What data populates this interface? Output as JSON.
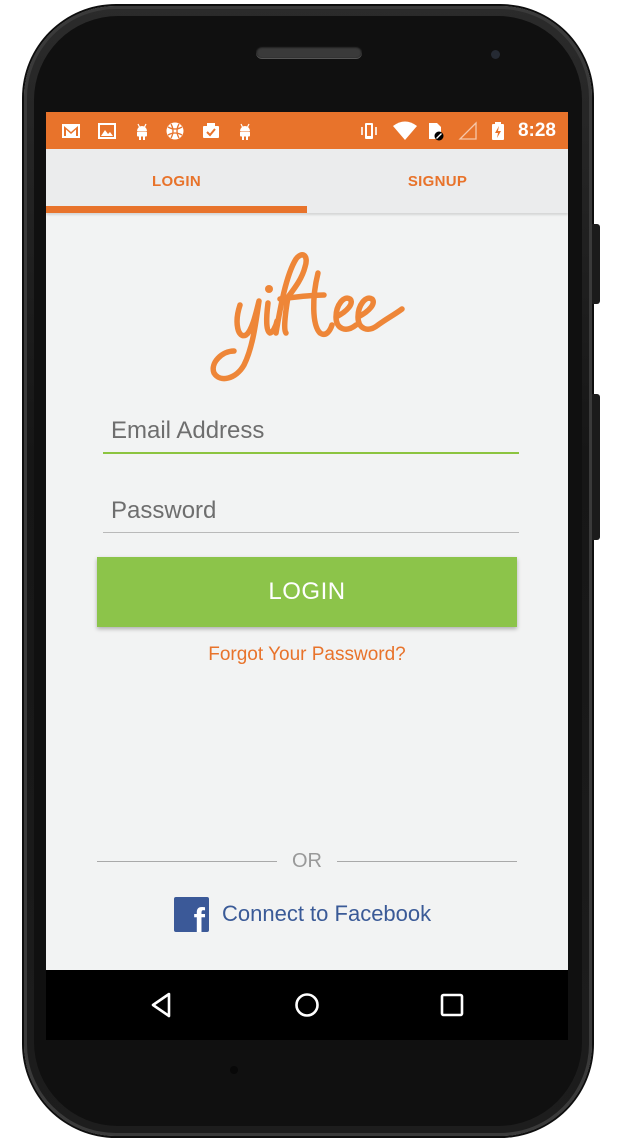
{
  "status_bar": {
    "time": "8:28",
    "left_icons": [
      "gmail-icon",
      "gallery-icon",
      "android-icon",
      "basketball-icon",
      "checklist-icon",
      "android-icon"
    ],
    "right_icons": [
      "vibrate-icon",
      "wifi-icon",
      "sim-blocked-icon",
      "no-signal-icon",
      "battery-charging-icon"
    ],
    "background_color": "#e8732b"
  },
  "tabs": [
    {
      "label": "LOGIN",
      "selected": true
    },
    {
      "label": "SIGNUP",
      "selected": false
    }
  ],
  "logo": {
    "text": "yiftee"
  },
  "form": {
    "email_placeholder": "Email Address",
    "email_value": "",
    "password_placeholder": "Password",
    "password_value": "",
    "login_label": "LOGIN",
    "forgot_label": "Forgot Your Password?"
  },
  "divider": {
    "text": "OR"
  },
  "facebook": {
    "label": "Connect to Facebook",
    "icon": "facebook-icon"
  },
  "nav_bar": {
    "buttons": [
      "back-icon",
      "home-icon",
      "recent-apps-icon"
    ]
  },
  "colors": {
    "accent": "#e8732b",
    "login_button": "#8cc44a",
    "email_underline": "#8cc43f",
    "facebook": "#3b5998"
  }
}
